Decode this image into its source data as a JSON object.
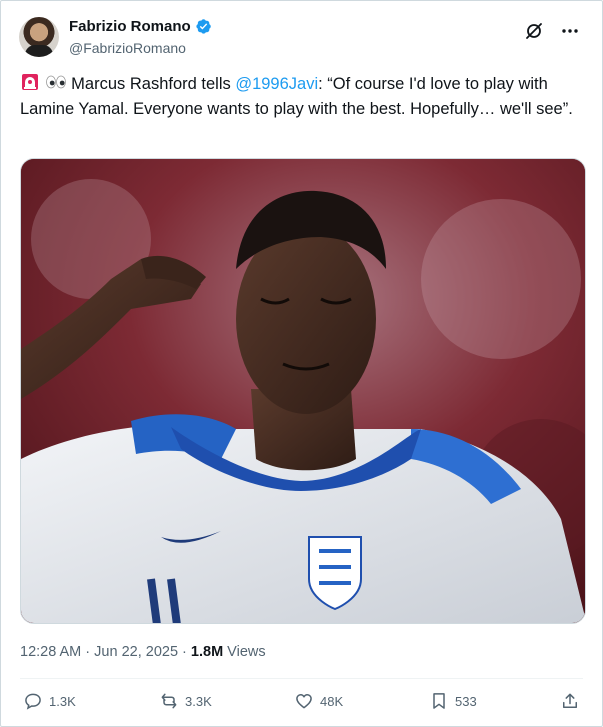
{
  "author": {
    "display_name": "Fabrizio Romano",
    "handle": "@FabrizioRomano",
    "verified": true,
    "verified_color": "#1d9bf0"
  },
  "tweet": {
    "emoji_1": "siren-emoji",
    "emoji_2": "eyes-emoji",
    "text_before": " Marcus Rashford tells ",
    "mention": "@1996Javi",
    "text_after": ": “Of course I'd love to play with Lamine Yamal. Everyone wants to play with the best. Hopefully… we'll see”."
  },
  "media": {
    "image": "photo-marcus-rashford-england-shirt"
  },
  "meta": {
    "time": "12:28 AM",
    "separator": " · ",
    "date": "Jun 22, 2025",
    "separator2": " · ",
    "views_count": "1.8M",
    "views_label": " Views"
  },
  "actions": {
    "replies": "1.3K",
    "reposts": "3.3K",
    "likes": "48K",
    "bookmarks": "533"
  },
  "colors": {
    "text": "#0f1419",
    "secondary": "#536471",
    "accent": "#1d9bf0",
    "border": "#cfd9de"
  }
}
